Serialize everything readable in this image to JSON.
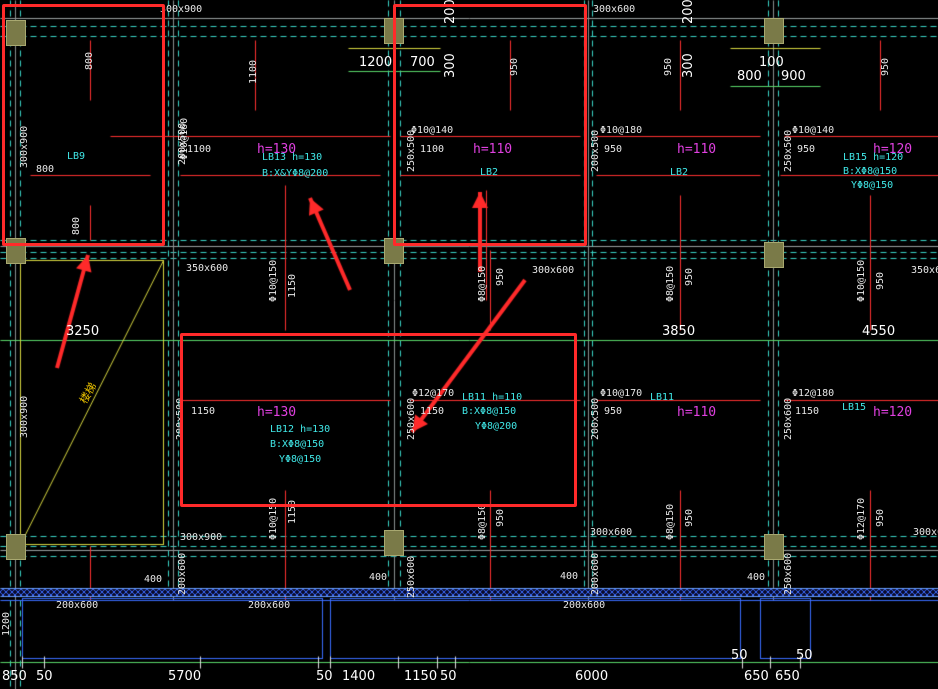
{
  "beam_labels": {
    "b300x900_top": "300x900",
    "b300x600_top": "300x600",
    "b300x900_left": "300x900",
    "b200x500_a": "200x500",
    "b250x500_a": "250x500",
    "b200x500_b": "200x500",
    "b250x500_b": "250x500",
    "b350x600": "350x600",
    "b300x600_mid": "300x600",
    "b350x600_r": "350x600",
    "b300x900_left2": "300x900",
    "b200x500_c": "200x500",
    "b250x600_c": "250x600",
    "b200x500_d": "200x500",
    "b250x600_d": "250x600",
    "b300x900_bot": "300x900",
    "b300x600_bot": "300x600",
    "b300x600_bot2": "300x600",
    "b200x600_a": "200x600",
    "b200x600_b": "200x600",
    "b200x600_c": "200x600",
    "b200x600_v1": "200x600",
    "b250x600_v2": "250x600",
    "b200x600_v3": "200x600",
    "b250x600_v4": "250x600"
  },
  "slabs": {
    "lb9": "LB9",
    "lb13_h": "h=130",
    "lb13": "LB13  h=130",
    "lb13_b": "B:X&YΦ8@200",
    "h110_a": "h=110",
    "lb2_a": "LB2",
    "h110_b": "h=110",
    "lb2_b": "LB2",
    "h120_a": "h=120",
    "lb15_a": "LB15  h=120",
    "lb15_a_b": "B:XΦ8@150",
    "lb15_a_y": "YΦ8@150",
    "h130_b": "h=130",
    "lb12": "LB12  h=130",
    "lb12_b": "B:XΦ8@150",
    "lb12_y": "YΦ8@150",
    "lb11": "LB11  h=110",
    "lb11_b": "B:XΦ8@150",
    "lb11_y": "YΦ8@200",
    "lb11_b2": "LB11",
    "h110_c": "h=110",
    "lb15_b": "LB15",
    "h120_b": "h=120",
    "stair": "楼梯"
  },
  "rebar": {
    "r1": "Φ10@160",
    "r2": "Φ10@140",
    "r3": "Φ10@180",
    "r4": "Φ10@140",
    "r5": "Φ10@150",
    "r6": "Φ8@150",
    "r7": "Φ8@150",
    "r8": "Φ10@150",
    "r9": "Φ12@170",
    "r10": "Φ10@170",
    "r11": "Φ12@180",
    "r12": "Φ10@150",
    "r13": "Φ8@150",
    "r14": "Φ8@150",
    "r15": "Φ12@170"
  },
  "small_dims": {
    "d800a": "800",
    "d800b": "800",
    "d800c": "800",
    "d1100a": "1100",
    "d1100b": "1100",
    "d1100c": "1100",
    "d950a": "950",
    "d950b": "950",
    "d950c": "950",
    "d950d": "950",
    "d950e": "950",
    "d950f": "950",
    "d950g": "950",
    "d1150a": "1150",
    "d1150b": "1150",
    "d1150c": "1150",
    "d1150d": "1150",
    "d950h": "950",
    "d950i": "950",
    "d950j": "950",
    "d950k": "950",
    "d950l": "950",
    "d1150e": "1150",
    "d1150f": "1150",
    "d950m": "950",
    "d950n": "950",
    "d400a": "400",
    "d400b": "400",
    "d400c": "400",
    "d400d": "400",
    "d1200": "1200"
  },
  "large_dims": {
    "top_1200": "1200",
    "top_700": "700",
    "top_300": "300",
    "top_200": "200",
    "top_300b": "300",
    "top_200b": "200",
    "top_800": "800",
    "top_100": "100",
    "top_900": "900",
    "mid_3250": "3250",
    "mid_3850": "3850",
    "mid_4550": "4550",
    "bot_850": "850",
    "bot_50a": "50",
    "bot_5700": "5700",
    "bot_50b": "50",
    "bot_1400": "1400",
    "bot_1150": "1150",
    "bot_50c": "50",
    "bot_6000": "6000",
    "bot_50d": "50",
    "bot_650a": "650",
    "bot_650b": "650",
    "bot_50e": "50"
  },
  "colors": {
    "grid_dashed": "#3ad6c8",
    "beam_line": "#e0e0e0",
    "rebar_line": "#ff3030",
    "annotation_red": "#ff2a2a",
    "column_fill": "#7a7a48",
    "hatch_blue": "#3a6cff",
    "stair_line": "#d8d840"
  }
}
